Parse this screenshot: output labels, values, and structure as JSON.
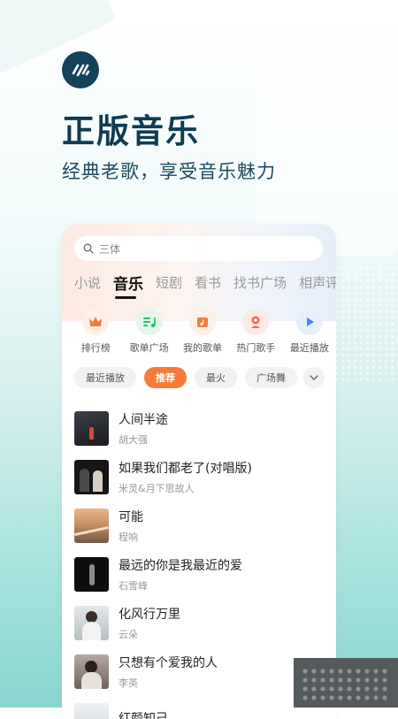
{
  "hero": {
    "title": "正版音乐",
    "subtitle": "经典老歌，享受音乐魅力"
  },
  "search": {
    "placeholder": "三体"
  },
  "tabs": [
    {
      "label": "小说"
    },
    {
      "label": "音乐",
      "active": true
    },
    {
      "label": "短剧"
    },
    {
      "label": "看书"
    },
    {
      "label": "找书广场"
    },
    {
      "label": "相声评"
    }
  ],
  "quick_icons": [
    {
      "label": "排行榜",
      "icon": "crown-icon",
      "color": "#f77a3a"
    },
    {
      "label": "歌单广场",
      "icon": "playlist-icon",
      "color": "#27c26c"
    },
    {
      "label": "我的歌单",
      "icon": "music-folder-icon",
      "color": "#f77a3a"
    },
    {
      "label": "热门歌手",
      "icon": "singer-icon",
      "color": "#f26a5a"
    },
    {
      "label": "最近播放",
      "icon": "play-icon",
      "color": "#4a86f4"
    }
  ],
  "filters": [
    {
      "label": "最近播放"
    },
    {
      "label": "推荐",
      "active": true
    },
    {
      "label": "最火"
    },
    {
      "label": "广场舞"
    }
  ],
  "songs": [
    {
      "title": "人间半途",
      "artist": "胡大强",
      "cover": "#2b2d33"
    },
    {
      "title": "如果我们都老了(对唱版)",
      "artist": "米灵&月下思故人",
      "cover": "#1c1c1c"
    },
    {
      "title": "可能",
      "artist": "程响",
      "cover": "#b9865c"
    },
    {
      "title": "最远的你是我最近的爱",
      "artist": "石雪峰",
      "cover": "#121212"
    },
    {
      "title": "化风行万里",
      "artist": "云朵",
      "cover": "#cfd3d6"
    },
    {
      "title": "只想有个爱我的人",
      "artist": "李英",
      "cover": "#9a8c86"
    },
    {
      "title": "红颜知己",
      "artist": "",
      "cover": "#dfe6ea"
    }
  ]
}
